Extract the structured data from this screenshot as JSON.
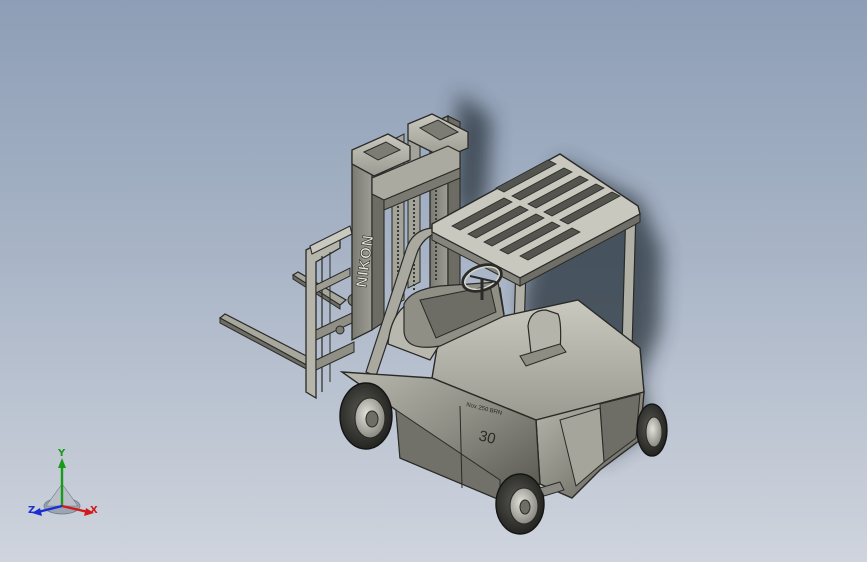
{
  "viewport": {
    "background_top": "#8d9eb6",
    "background_bottom": "#cfd4dd"
  },
  "model": {
    "name": "forklift",
    "mast_brand_text": "NIKON",
    "badge_text": "30",
    "body_text": "Nox 250 BRN",
    "body_color": "#8c8c82",
    "shadow_color": "#2e3640"
  },
  "triad": {
    "x_label": "X",
    "y_label": "Y",
    "z_label": "Z",
    "x_color": "#d11a1a",
    "y_color": "#1a9a1a",
    "z_color": "#1a2fd1"
  }
}
